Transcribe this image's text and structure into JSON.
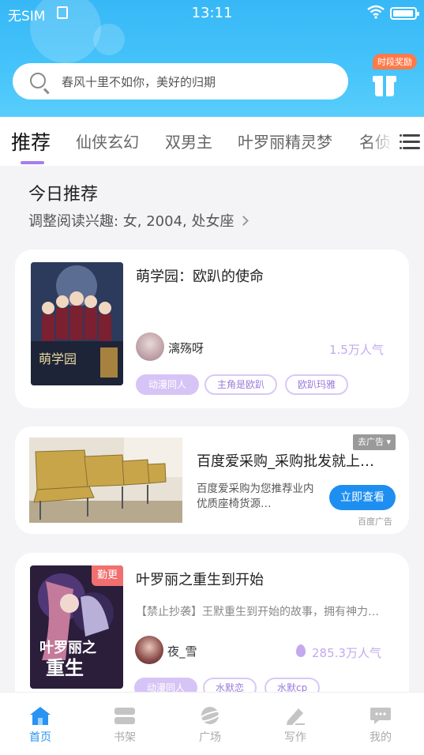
{
  "status_bar": {
    "carrier": "无SIM",
    "time": "13:11"
  },
  "search": {
    "placeholder": "春风十里不如你，美好的归期"
  },
  "reward": {
    "label": "时段奖励"
  },
  "tabs": [
    {
      "label": "推荐",
      "active": true
    },
    {
      "label": "仙侠玄幻"
    },
    {
      "label": "双男主"
    },
    {
      "label": "叶罗丽精灵梦"
    },
    {
      "label": "名侦探"
    }
  ],
  "section": {
    "title": "今日推荐",
    "subtitle": "调整阅读兴趣: 女, 2004, 处女座"
  },
  "book1": {
    "title": "萌学园：欧趴的使命",
    "author": "漓殇呀",
    "popularity": "1.5万人气",
    "tags": [
      "动漫同人",
      "主角是欧趴",
      "欧趴玛雅"
    ]
  },
  "ad": {
    "label": "去广告",
    "title": "百度爱采购_采购批发就上百度爱采购",
    "description": "百度爱采购为您推荐业内优质座椅货源…",
    "button": "立即查看",
    "source": "百度广告"
  },
  "book2": {
    "badge": "勤更",
    "title": "叶罗丽之重生到开始",
    "description": "【禁止抄袭】王默重生到开始的故事，拥有神力的王默",
    "author": "夜_雪",
    "popularity": "285.3万人气",
    "tags": [
      "动漫同人",
      "水默恋",
      "水默cp"
    ]
  },
  "bottom_nav": [
    {
      "label": "首页",
      "icon": "home-icon",
      "active": true
    },
    {
      "label": "书架",
      "icon": "bookshelf-icon"
    },
    {
      "label": "广场",
      "icon": "planet-icon"
    },
    {
      "label": "写作",
      "icon": "pen-icon"
    },
    {
      "label": "我的",
      "icon": "chat-bubble-icon"
    }
  ],
  "colors": {
    "header": "#46c4fa",
    "accent_purple": "#a77cf0",
    "nav_active": "#2a93f2",
    "badge_red": "#f26f6f"
  }
}
